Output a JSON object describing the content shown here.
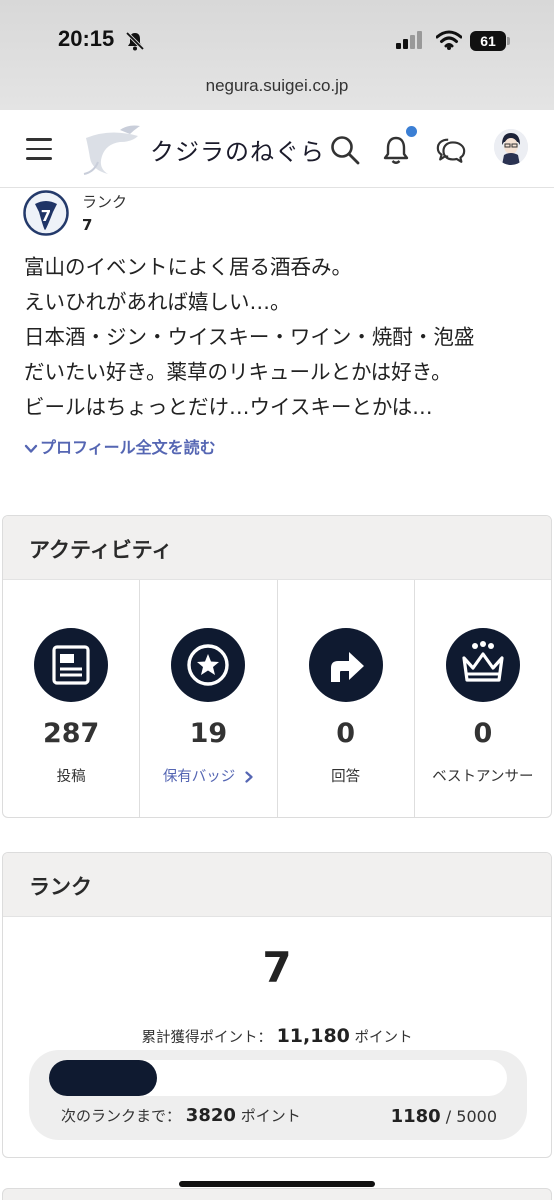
{
  "status_bar": {
    "time": "20:15",
    "battery": "61"
  },
  "browser": {
    "url": "negura.suigei.co.jp"
  },
  "header": {
    "logo_text": "クジラのねぐら"
  },
  "profile": {
    "rank_label": "ランク",
    "rank_value": "7",
    "bio_lines": [
      "富山のイベントによく居る酒呑み。",
      "えいひれがあれば嬉しい…。",
      "日本酒・ジン・ウイスキー・ワイン・焼酎・泡盛",
      "だいたい好き。薬草のリキュールとかは好き。",
      "ビールはちょっとだけ…ウイスキーとかは…"
    ],
    "read_more": "プロフィール全文を読む"
  },
  "activity": {
    "title": "アクティビティ",
    "stats": [
      {
        "icon": "document-icon",
        "value": "287",
        "label": "投稿"
      },
      {
        "icon": "badge-star-icon",
        "value": "19",
        "label": "保有バッジ"
      },
      {
        "icon": "reply-arrow-icon",
        "value": "0",
        "label": "回答"
      },
      {
        "icon": "crown-icon",
        "value": "0",
        "label": "ベストアンサー"
      }
    ]
  },
  "rank": {
    "title": "ランク",
    "value": "7",
    "total_prefix": "累計獲得ポイント：",
    "total_points": "11,180",
    "total_unit": "ポイント",
    "next_prefix": "次のランクまで：",
    "next_points": "3820",
    "next_unit": "ポイント",
    "current": "1180",
    "separator": "/",
    "target": "5000",
    "progress_fraction": 0.236
  },
  "colors": {
    "accent_navy": "#0f1a30",
    "link_blue": "#5566b3",
    "notification_blue": "#3b7fd4"
  }
}
